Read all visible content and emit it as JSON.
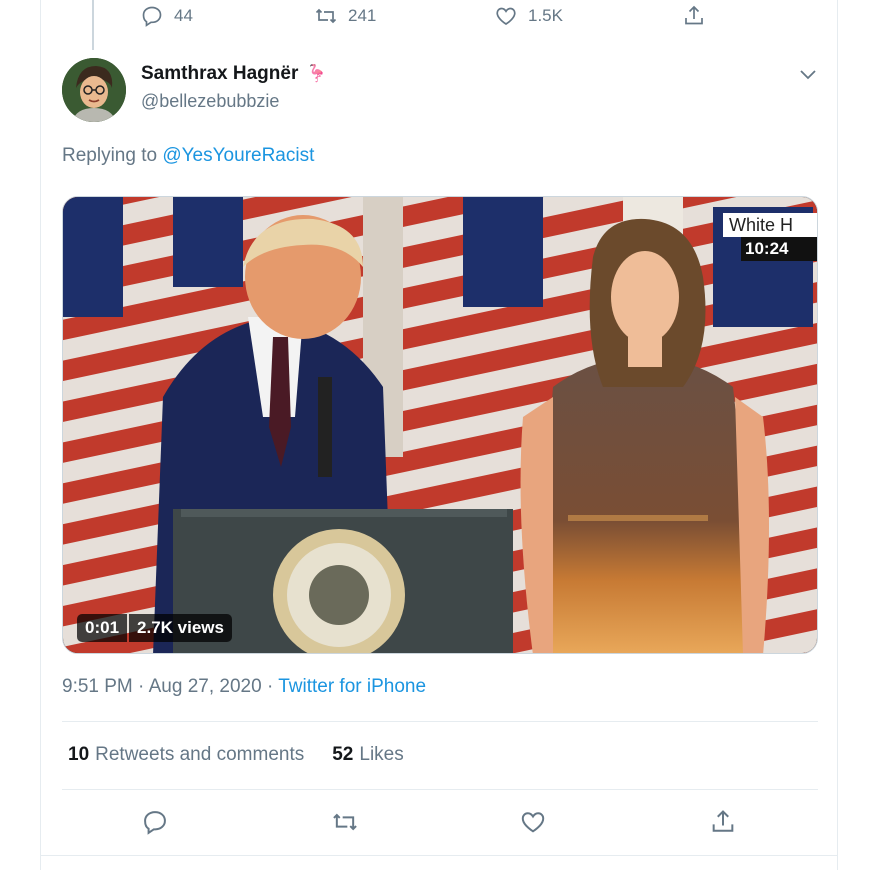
{
  "prev_tweet": {
    "reply_count": "44",
    "retweet_count": "241",
    "like_count": "1.5K"
  },
  "tweet": {
    "display_name": "Samthrax Hagnër",
    "name_emoji": "🦩",
    "handle": "@bellezebubbzie",
    "replying_prefix": "Replying to",
    "replying_to": "@YesYoureRacist",
    "video": {
      "overlay_channel": "White H",
      "overlay_time": "10:24",
      "duration": "0:01",
      "views": "2.7K views"
    },
    "time": "9:51 PM",
    "separator": "·",
    "date": "Aug 27, 2020",
    "source": "Twitter for iPhone",
    "retweets_count": "10",
    "retweets_label": "Retweets and comments",
    "likes_count": "52",
    "likes_label": "Likes"
  },
  "icons": {
    "reply": "reply-icon",
    "retweet": "retweet-icon",
    "like": "heart-icon",
    "share": "share-icon",
    "more": "chevron-down-icon"
  },
  "colors": {
    "link": "#1b95e0",
    "muted": "#657786",
    "text": "#14171a",
    "border": "#e6ecf0"
  }
}
